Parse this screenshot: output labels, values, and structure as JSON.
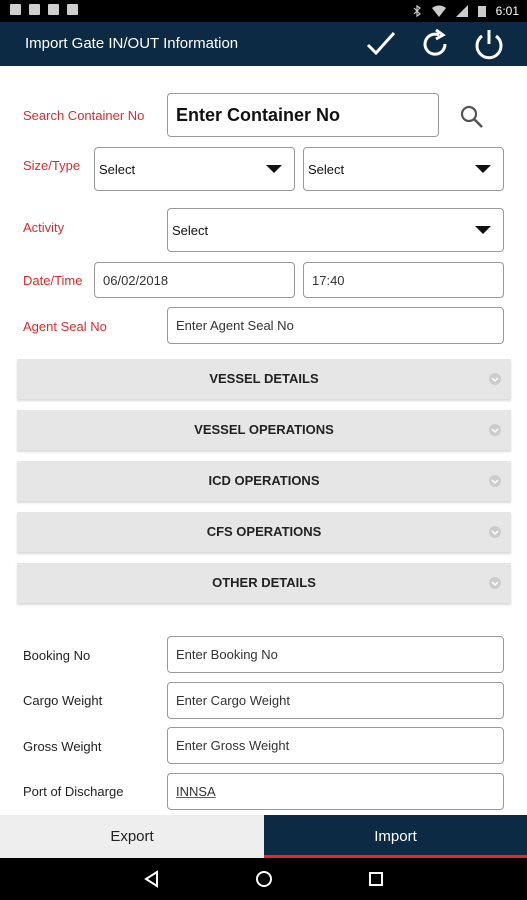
{
  "status_bar": {
    "time": "6:01"
  },
  "app_bar": {
    "title": "Import Gate IN/OUT Information"
  },
  "form": {
    "search_label": "Search Container No",
    "search_placeholder": "Enter Container No",
    "size_type_label": "Size/Type",
    "size_select_value": "Select",
    "type_select_value": "Select",
    "activity_label": "Activity",
    "activity_select_value": "Select",
    "datetime_label": "Date/Time",
    "date_value": "06/02/2018",
    "time_value": "17:40",
    "agent_seal_label": "Agent Seal No",
    "agent_seal_placeholder": "Enter Agent Seal No"
  },
  "sections": [
    {
      "label": "VESSEL DETAILS"
    },
    {
      "label": "VESSEL OPERATIONS"
    },
    {
      "label": "ICD OPERATIONS"
    },
    {
      "label": "CFS OPERATIONS"
    },
    {
      "label": "OTHER DETAILS"
    }
  ],
  "lower_form": {
    "booking_label": "Booking No",
    "booking_placeholder": "Enter Booking No",
    "cargo_label": "Cargo Weight",
    "cargo_placeholder": "Enter Cargo Weight",
    "gross_label": "Gross Weight",
    "gross_placeholder": "Enter Gross Weight",
    "port_label": "Port of Discharge",
    "port_value": "INNSA"
  },
  "tabs": {
    "export_label": "Export",
    "import_label": "Import"
  },
  "colors": {
    "primary": "#0d2a45",
    "accent": "#e5262b",
    "section_bg": "#e6e6e6"
  }
}
